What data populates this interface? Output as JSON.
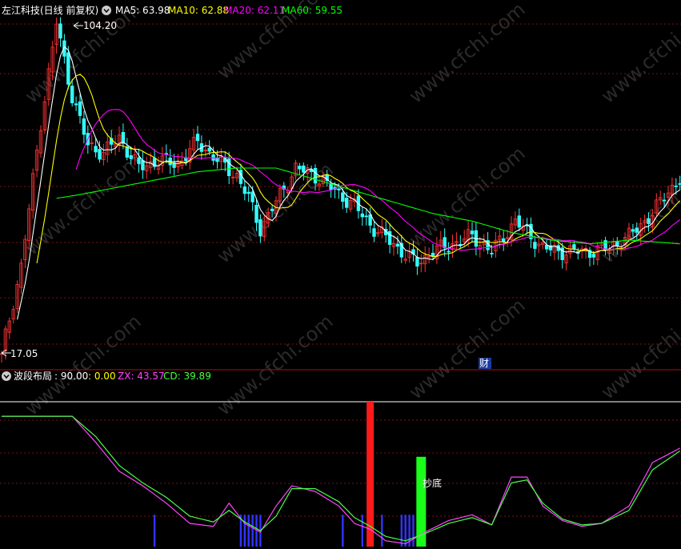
{
  "header": {
    "title": "左江科技(日线 前复权)",
    "ma5": "MA5: 63.98",
    "ma10": "MA10: 62.88",
    "ma20": "MA20: 62.11",
    "ma60": "MA60: 59.55"
  },
  "sub_header": {
    "title": "波段布局",
    "v1": ": 90.00",
    "v2": ": 0.00",
    "zx": "ZX: 43.57",
    "cd": "CD: 39.89"
  },
  "annotations": {
    "high": "104.20",
    "low": "17.05",
    "cai": "财",
    "chaodi": "抄底"
  },
  "watermark": "www.cfchi.com",
  "colors": {
    "up": "#ff3333",
    "down": "#33ffff",
    "ma5": "#ffffff",
    "ma10": "#ffff00",
    "ma20": "#ff00ff",
    "ma60": "#00ff00",
    "zx": "#ff44ff",
    "cd": "#44ff44",
    "signal": "#3333ff",
    "bar_red": "#ff1a1a",
    "bar_green": "#1aff1a",
    "grid": "#7a1515",
    "divider": "#b01010"
  },
  "chart_data": {
    "type": "line",
    "price_panel": {
      "high_label": 104.2,
      "low_label": 17.05,
      "ma": [
        {
          "name": "MA5",
          "value": 63.98
        },
        {
          "name": "MA10",
          "value": 62.88
        },
        {
          "name": "MA20",
          "value": 62.11
        },
        {
          "name": "MA60",
          "value": 59.55
        }
      ],
      "close_anchors": [
        [
          0,
          17
        ],
        [
          5,
          40
        ],
        [
          10,
          78
        ],
        [
          14,
          104
        ],
        [
          18,
          85
        ],
        [
          22,
          72
        ],
        [
          26,
          70
        ],
        [
          30,
          74
        ],
        [
          35,
          66
        ],
        [
          40,
          68
        ],
        [
          45,
          67
        ],
        [
          50,
          73
        ],
        [
          55,
          68
        ],
        [
          60,
          64
        ],
        [
          63,
          58
        ],
        [
          66,
          50
        ],
        [
          70,
          57
        ],
        [
          75,
          66
        ],
        [
          80,
          64
        ],
        [
          85,
          60
        ],
        [
          90,
          56
        ],
        [
          95,
          50
        ],
        [
          100,
          46
        ],
        [
          103,
          43
        ],
        [
          106,
          41
        ],
        [
          110,
          44
        ],
        [
          115,
          46
        ],
        [
          120,
          48
        ],
        [
          125,
          44
        ],
        [
          128,
          48
        ],
        [
          131,
          52
        ],
        [
          135,
          48
        ],
        [
          138,
          45
        ],
        [
          142,
          44
        ],
        [
          146,
          44
        ],
        [
          150,
          44
        ],
        [
          155,
          45
        ],
        [
          160,
          48
        ],
        [
          166,
          54
        ],
        [
          170,
          60
        ],
        [
          173,
          63
        ]
      ],
      "ma60_anchors": [
        [
          14,
          58
        ],
        [
          20,
          59
        ],
        [
          30,
          61
        ],
        [
          40,
          63
        ],
        [
          50,
          65
        ],
        [
          60,
          66
        ],
        [
          70,
          66
        ],
        [
          80,
          63
        ],
        [
          90,
          60
        ],
        [
          100,
          57
        ],
        [
          110,
          54
        ],
        [
          120,
          52
        ],
        [
          130,
          49
        ],
        [
          140,
          47
        ],
        [
          150,
          46
        ],
        [
          160,
          47
        ],
        [
          173,
          46
        ]
      ]
    },
    "indicator_panel": {
      "name": "波段布局",
      "levels": [
        90.0,
        0.0
      ],
      "series": [
        {
          "name": "ZX",
          "last": 43.57
        },
        {
          "name": "CD",
          "last": 39.89
        }
      ],
      "zx_anchors": [
        [
          0,
          90
        ],
        [
          18,
          90
        ],
        [
          24,
          72
        ],
        [
          30,
          52
        ],
        [
          36,
          42
        ],
        [
          42,
          30
        ],
        [
          48,
          16
        ],
        [
          54,
          14
        ],
        [
          58,
          30
        ],
        [
          62,
          16
        ],
        [
          66,
          10
        ],
        [
          70,
          28
        ],
        [
          74,
          42
        ],
        [
          80,
          38
        ],
        [
          86,
          28
        ],
        [
          90,
          16
        ],
        [
          94,
          12
        ],
        [
          98,
          4
        ],
        [
          103,
          2
        ],
        [
          108,
          10
        ],
        [
          114,
          18
        ],
        [
          120,
          22
        ],
        [
          125,
          15
        ],
        [
          130,
          48
        ],
        [
          134,
          48
        ],
        [
          138,
          28
        ],
        [
          143,
          18
        ],
        [
          148,
          14
        ],
        [
          153,
          16
        ],
        [
          160,
          28
        ],
        [
          166,
          58
        ],
        [
          173,
          68
        ]
      ],
      "cd_anchors": [
        [
          0,
          90
        ],
        [
          18,
          90
        ],
        [
          24,
          76
        ],
        [
          30,
          56
        ],
        [
          36,
          44
        ],
        [
          42,
          34
        ],
        [
          48,
          21
        ],
        [
          54,
          17
        ],
        [
          58,
          25
        ],
        [
          62,
          17
        ],
        [
          66,
          11
        ],
        [
          70,
          21
        ],
        [
          74,
          40
        ],
        [
          80,
          40
        ],
        [
          86,
          31
        ],
        [
          90,
          20
        ],
        [
          94,
          14
        ],
        [
          98,
          7
        ],
        [
          103,
          4
        ],
        [
          108,
          9
        ],
        [
          114,
          16
        ],
        [
          120,
          20
        ],
        [
          125,
          15
        ],
        [
          130,
          44
        ],
        [
          134,
          46
        ],
        [
          138,
          30
        ],
        [
          143,
          19
        ],
        [
          148,
          15
        ],
        [
          153,
          16
        ],
        [
          160,
          25
        ],
        [
          166,
          53
        ],
        [
          173,
          66
        ]
      ],
      "signal_bars": [
        39,
        61,
        62,
        63,
        64,
        65,
        66,
        87,
        92,
        97,
        102,
        103,
        104,
        105
      ],
      "red_bar": {
        "index": 94,
        "value": 100
      },
      "green_bar": {
        "index": 107,
        "value": 62
      }
    }
  }
}
